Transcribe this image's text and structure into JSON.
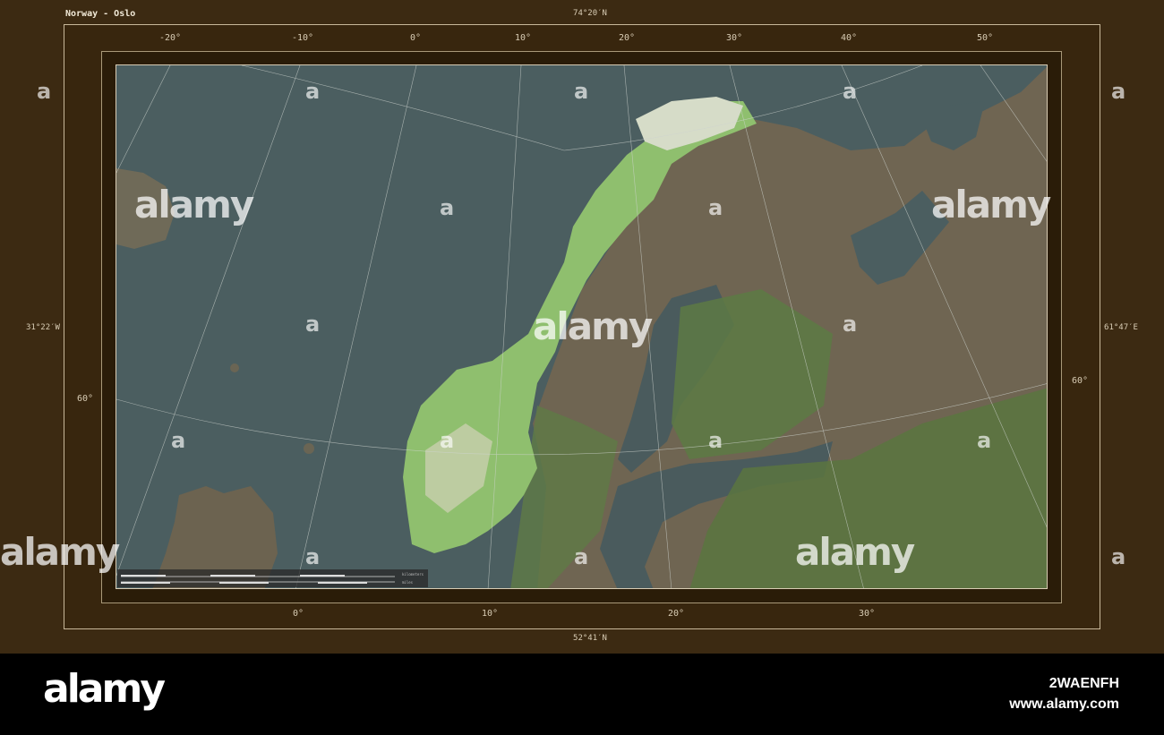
{
  "map": {
    "title": "Norway - Oslo",
    "lat_top": "74°20′N",
    "lat_bottom": "52°41′N",
    "lon_left": "31°22′W",
    "lon_right": "61°47′E",
    "top_ticks": [
      "-20°",
      "-10°",
      "0°",
      "10°",
      "20°",
      "30°",
      "40°",
      "50°"
    ],
    "bottom_ticks": [
      "0°",
      "10°",
      "20°",
      "30°"
    ],
    "left_ticks": [
      "60°"
    ],
    "right_ticks": [
      "60°"
    ],
    "scale_km_unit": "kilometers",
    "scale_mi_unit": "miles",
    "colors": {
      "sea": "#4b5e60",
      "norway": "#8fbf6e",
      "land": "#6f6552",
      "forest": "#5d7a44",
      "frame": "#3c2a12"
    }
  },
  "watermark": {
    "text": "alamy",
    "small_mark": "a"
  },
  "footer": {
    "logo": "alamy",
    "image_id": "2WAENFH",
    "url": "www.alamy.com"
  }
}
